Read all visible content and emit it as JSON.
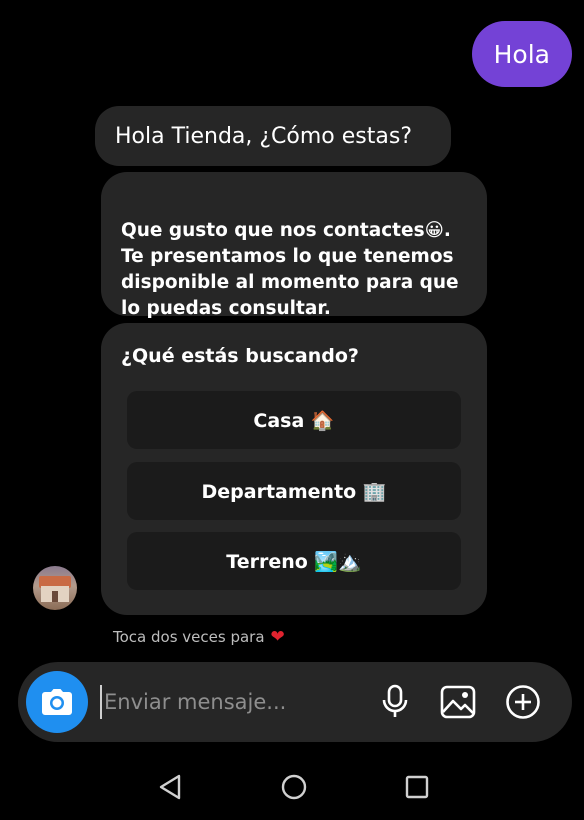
{
  "chat": {
    "outgoing": {
      "text": "Hola"
    },
    "incoming": [
      {
        "text": "Hola  Tienda, ¿Cómo estas?"
      },
      {
        "text": "Que gusto que nos contactes😀.\nTe presentamos lo que tenemos\ndisponible al momento para que\nlo puedas consultar."
      }
    ],
    "question": {
      "title": "¿Qué estás buscando?",
      "options": [
        {
          "label": "Casa 🏠"
        },
        {
          "label": "Departamento 🏢"
        },
        {
          "label": "Terreno 🏞️🏔️"
        }
      ]
    },
    "hint": {
      "text": "Toca dos veces para",
      "icon": "heart-icon",
      "color": "#e0232f"
    }
  },
  "composer": {
    "placeholder": "Enviar mensaje...",
    "icons": [
      "camera-icon",
      "microphone-icon",
      "gallery-icon",
      "add-icon"
    ],
    "accent": "#1f8ff0"
  },
  "navigation": {
    "icons": [
      "back-icon",
      "home-icon",
      "recent-apps-icon"
    ]
  },
  "colors": {
    "outgoing_bubble": "#7442d6",
    "incoming_bubble": "#262626",
    "background": "#000000"
  }
}
